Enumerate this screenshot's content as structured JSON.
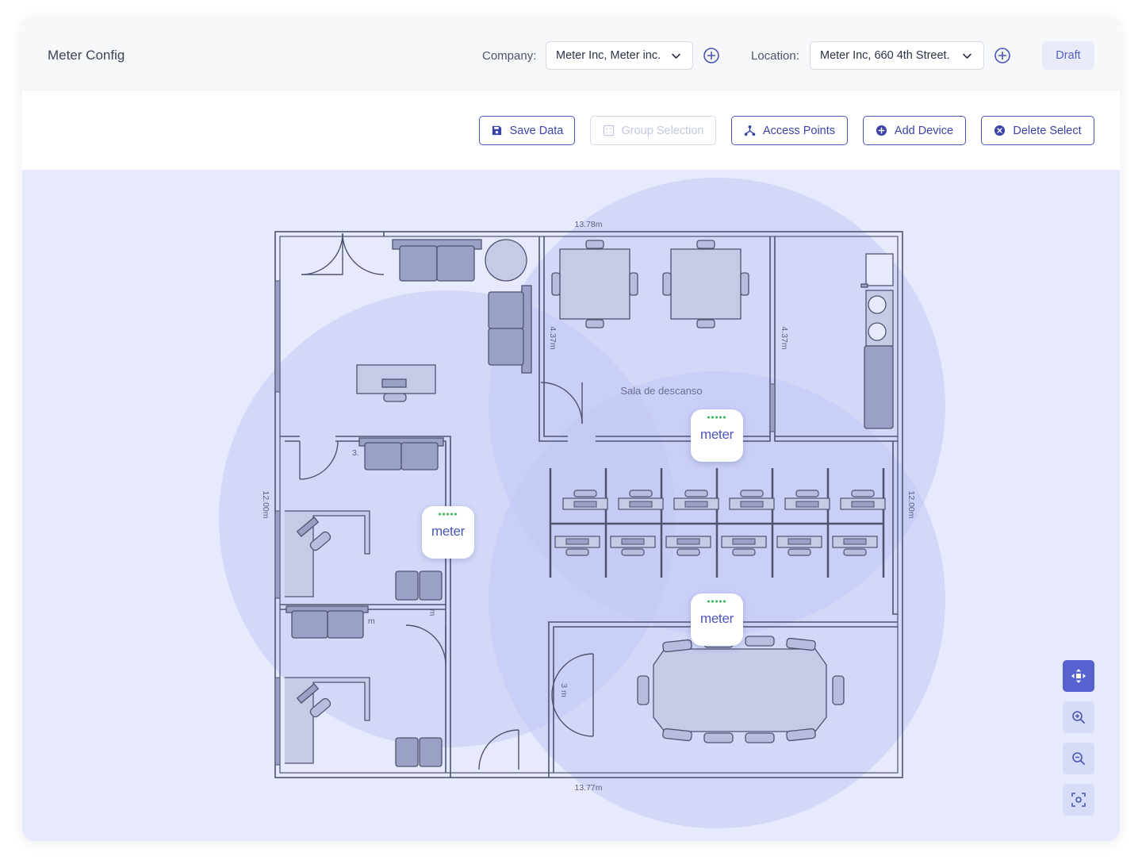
{
  "header": {
    "title": "Meter Config",
    "company_label": "Company:",
    "company_value": "Meter Inc, Meter inc.",
    "location_label": "Location:",
    "location_value": "Meter Inc, 660 4th Street.",
    "draft_label": "Draft"
  },
  "toolbar": {
    "save_label": "Save Data",
    "group_label": "Group Selection",
    "access_points_label": "Access Points",
    "add_device_label": "Add Device",
    "delete_label": "Delete Select"
  },
  "floorplan": {
    "dim_top": "13.78m",
    "dim_bottom": "13.77m",
    "dim_left": "12.00m",
    "dim_right": "12.00m",
    "dim_break_left": "4.37m",
    "dim_break_right": "4.37m",
    "dim_office": "3.",
    "dim_office2": "m",
    "dim_office3": "m",
    "dim_meeting_door": "3 m",
    "room_label": "Sala de descanso"
  },
  "access_points": [
    {
      "label": "meter"
    },
    {
      "label": "meter"
    },
    {
      "label": "meter"
    }
  ],
  "colors": {
    "accent": "#4b55b8",
    "coverage": "#c3c8f6",
    "canvas_bg": "#e7eafc"
  },
  "map_controls": [
    "move-icon",
    "zoom-in-icon",
    "zoom-out-icon",
    "focus-icon"
  ]
}
